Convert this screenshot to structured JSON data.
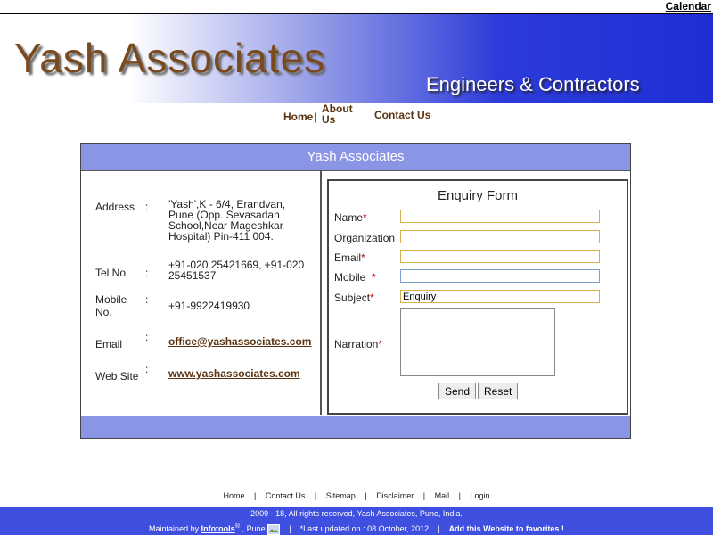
{
  "top": {
    "calendar": "Calendar"
  },
  "banner": {
    "logo": "Yash Associates",
    "tagline": "Engineers & Contractors"
  },
  "nav": {
    "home": "Home",
    "about": "About Us",
    "contact": "Contact Us",
    "sep": "|"
  },
  "panel": {
    "header": "Yash Associates",
    "address_label": "Address",
    "address": "'Yash',K - 6/4, Erandvan, Pune (Opp. Sevasadan School,Near Mageshkar Hospital) Pin-411 004.",
    "tel_label": "Tel No.",
    "tel": "+91-020 25421669, +91-020 25451537",
    "mobile_label": "Mobile No.",
    "mobile": "+91-9922419930",
    "email_label": "Email",
    "email": "office@yashassociates.com",
    "website_label": "Web Site",
    "website": "www.yashassociates.com",
    "colon": ":"
  },
  "form": {
    "title": "Enquiry Form",
    "name_label": "Name",
    "org_label": "Organization",
    "email_label": "Email",
    "mobile_label": "Mobile",
    "subject_label": "Subject",
    "subject_value": "Enquiry",
    "narration_label": "Narration",
    "required": "*",
    "send": "Send",
    "reset": "Reset"
  },
  "footer": {
    "links": [
      "Home",
      "Contact Us",
      "Sitemap",
      "Disclaimer",
      "Mail",
      "Login"
    ],
    "sep": "|",
    "copyright": "2009 - 18, All rights reserved, Yash Associates, Pune, India.",
    "maintained": "Maintained by",
    "infotools": "Infotools",
    "reg": "®",
    "pune": ", Pune",
    "updated": "*Last updated on : 08 October, 2012",
    "favorites": "Add this Website to favorites !"
  },
  "colors": {
    "accent_blue": "#3f4fe0",
    "header_blue": "#8a95e6",
    "brown": "#5b3311"
  }
}
